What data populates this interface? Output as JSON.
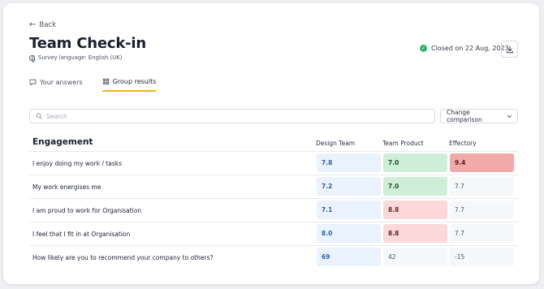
{
  "back_label": "Back",
  "page_title": "Team Check-in",
  "survey_language": "Survey language: English (UK)",
  "status_text": "Closed on 22 Aug, 2023",
  "tabs": [
    {
      "label": "Your answers"
    },
    {
      "label": "Group results"
    }
  ],
  "search": {
    "placeholder": "Search",
    "value": ""
  },
  "comparison_button": "Change comparison",
  "section_title": "Engagement",
  "columns": [
    "Design Team",
    "Team Product",
    "Effectory"
  ],
  "rows": [
    {
      "question": "I enjoy doing my work / tasks",
      "values": [
        "7.8",
        "7.0",
        "9.4"
      ]
    },
    {
      "question": "My work energises me",
      "values": [
        "7.2",
        "7.0",
        "7.7"
      ]
    },
    {
      "question": "I am proud to work for Organisation",
      "values": [
        "7.1",
        "8.8",
        "7.7"
      ]
    },
    {
      "question": "I feel that I fit in at Organisation",
      "values": [
        "8.0",
        "8.8",
        "7.7"
      ]
    },
    {
      "question": "How likely are you to recommend your company to others?",
      "values": [
        "69",
        "42",
        "-15"
      ]
    }
  ],
  "colors": {
    "accent": "#f3b21c",
    "success": "#2eb368",
    "cell_blue": "#eaf2fd",
    "cell_green": "#cfeed7",
    "cell_pink": "#fbd9d9",
    "cell_red": "#f4a9a9"
  },
  "icons": {
    "back": "arrow-left-icon",
    "language": "globe-icon",
    "status": "check-circle-icon",
    "download": "download-icon",
    "tab_answers": "speech-bubble-icon",
    "tab_group": "group-icon",
    "search": "search-icon",
    "comparison": "chevron-down-icon"
  }
}
